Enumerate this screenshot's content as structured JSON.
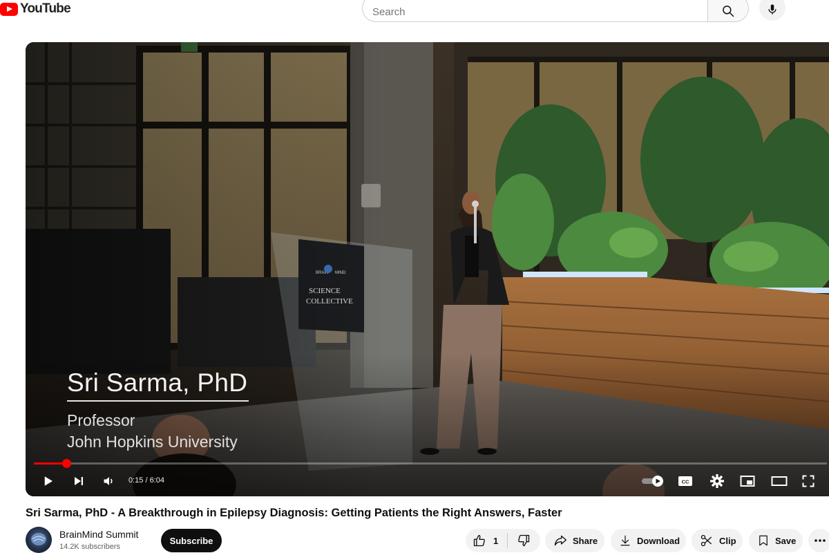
{
  "header": {
    "logo_text": "YouTube",
    "search_placeholder": "Search",
    "search_value": ""
  },
  "player": {
    "lower_third": {
      "name": "Sri Sarma, PhD",
      "role": "Professor",
      "organization": "John Hopkins University"
    },
    "podium_sign": {
      "line1": "BRAIN",
      "line2": "MIND",
      "line3": "SCIENCE",
      "line4": "COLLECTIVE"
    },
    "time_display": "0:15 / 6:04",
    "progress_fraction": 0.041,
    "autoplay": true,
    "colors": {
      "progress": "#ff0000"
    }
  },
  "video": {
    "title": "Sri Sarma, PhD - A Breakthrough in Epilepsy Diagnosis: Getting Patients the Right Answers, Faster"
  },
  "channel": {
    "name": "BrainMind Summit",
    "subscribers": "14.2K subscribers",
    "subscribe_label": "Subscribe"
  },
  "actions": {
    "like_count": "1",
    "share_label": "Share",
    "download_label": "Download",
    "clip_label": "Clip",
    "save_label": "Save"
  },
  "icons": [
    "youtube-logo-icon",
    "search-icon",
    "mic-icon",
    "play-icon",
    "next-icon",
    "volume-icon",
    "autoplay-toggle-icon",
    "captions-icon",
    "settings-icon",
    "miniplayer-icon",
    "theater-icon",
    "fullscreen-icon",
    "like-icon",
    "dislike-icon",
    "share-icon",
    "download-icon",
    "clip-icon",
    "save-icon",
    "more-icon"
  ]
}
